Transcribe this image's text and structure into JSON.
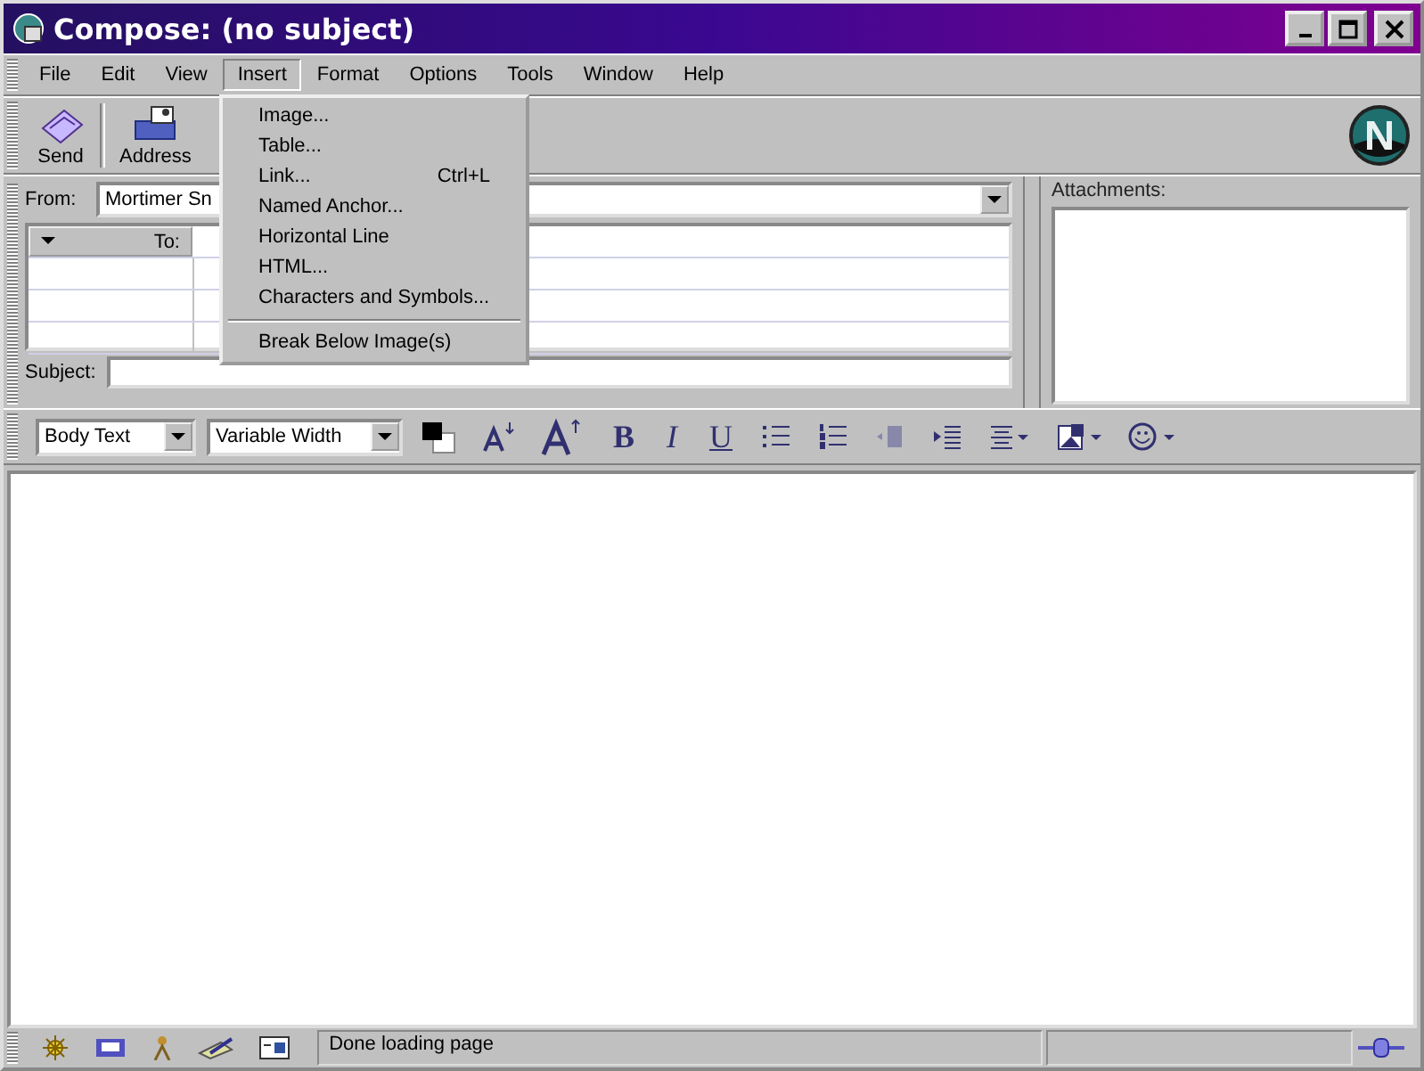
{
  "window": {
    "title": "Compose: (no subject)"
  },
  "menubar": [
    {
      "label": "File",
      "selected": false
    },
    {
      "label": "Edit",
      "selected": false
    },
    {
      "label": "View",
      "selected": false
    },
    {
      "label": "Insert",
      "selected": true
    },
    {
      "label": "Format",
      "selected": false
    },
    {
      "label": "Options",
      "selected": false
    },
    {
      "label": "Tools",
      "selected": false
    },
    {
      "label": "Window",
      "selected": false
    },
    {
      "label": "Help",
      "selected": false
    }
  ],
  "insert_menu": [
    {
      "kind": "item",
      "label": "Image..."
    },
    {
      "kind": "item",
      "label": "Table..."
    },
    {
      "kind": "item",
      "label": "Link...",
      "shortcut": "Ctrl+L"
    },
    {
      "kind": "item",
      "label": "Named Anchor..."
    },
    {
      "kind": "item",
      "label": "Horizontal Line"
    },
    {
      "kind": "item",
      "label": "HTML..."
    },
    {
      "kind": "item",
      "label": "Characters and Symbols..."
    },
    {
      "kind": "separator"
    },
    {
      "kind": "item",
      "label": "Break Below Image(s)"
    }
  ],
  "toolbar": [
    {
      "kind": "send",
      "label": "Send"
    },
    {
      "kind": "address",
      "label": "Address"
    }
  ],
  "from": {
    "label": "From:",
    "value": "Mortimer Sn"
  },
  "recipients": {
    "header": "To:"
  },
  "subject": {
    "label": "Subject:"
  },
  "attachments": {
    "label": "Attachments:"
  },
  "format_bar": {
    "paragraph": "Body Text",
    "font": "Variable Width",
    "bold": "B",
    "italic": "I",
    "underline": "U"
  },
  "status_bar": {
    "text": "Done loading page"
  }
}
